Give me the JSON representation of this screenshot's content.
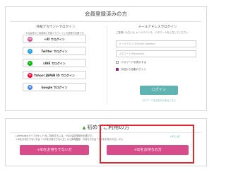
{
  "login_panel": {
    "title": "会員登録済みの方",
    "external": {
      "heading": "外部アカウントでログイン",
      "note": "※当会員のご利用時に外部アカウントとの連携が必要です。",
      "buttons": [
        {
          "label": "+ID でログイン",
          "icon": "plus-id-icon",
          "color": "#d84c8b",
          "glyph": "ID"
        },
        {
          "label": "Twitter でログイン",
          "icon": "twitter-icon",
          "color": "#1da1f2",
          "glyph": "t"
        },
        {
          "label": "LINE でログイン",
          "icon": "line-icon",
          "color": "#00b900",
          "glyph": "L"
        },
        {
          "label": "Yahoo! JAPAN ID でログイン",
          "icon": "yahoo-icon",
          "color": "#ff0033",
          "glyph": "Y!"
        },
        {
          "label": "Google でログイン",
          "icon": "google-icon",
          "color": "#4285f4",
          "glyph": "G"
        }
      ]
    },
    "email": {
      "heading": "メールアドレスでログイン",
      "note": "ご登録いただいた メールアドレス、パスワードを入力してください",
      "email_placeholder": "メールアドレス/Email Address",
      "password_placeholder": "パスワード/Password",
      "show_password_label": "パスワードを表示する",
      "keep_login_label": "次回から自動ログイン",
      "keep_login_checked": true,
      "login_button": "ログイン",
      "forgot_link": "パスワードをお忘れの方はこちら"
    }
  },
  "first_time": {
    "title": "初めてご利用の方",
    "note_line1": "LivePocket(ライブポケット)をご利用するには、+IDの会員登録が必要です。",
    "note_line2": "+IDをお持ちでない方は「+IDをお持ちでない方」から新規登録、お持ちの方は「+IDをお持ちの方」から",
    "help_link": "+IDとは？",
    "button_no_id": "+IDをお持ちでない方",
    "button_has_id": "+IDをお持ちの方"
  },
  "colors": {
    "accent_pink": "#d84c8b",
    "login_teal": "#5fb3b0",
    "highlight_red": "#e3262d"
  }
}
